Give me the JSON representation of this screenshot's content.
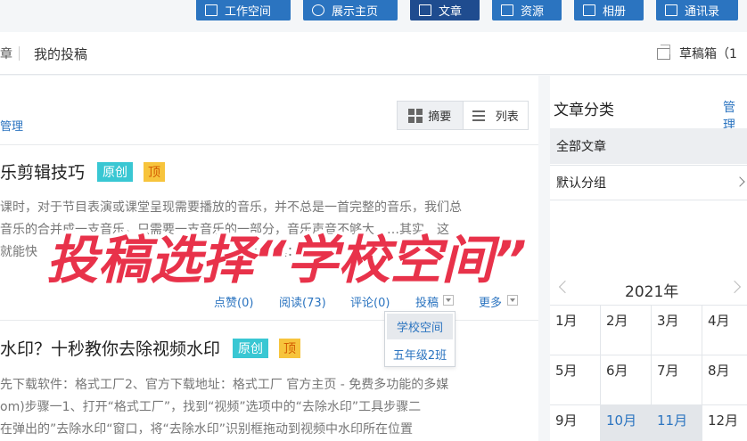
{
  "nav": {
    "items": [
      {
        "label": "工作空间",
        "icon": "workspace-icon"
      },
      {
        "label": "展示主页",
        "icon": "user-icon"
      },
      {
        "label": "文章",
        "icon": "article-icon"
      },
      {
        "label": "资源",
        "icon": "resource-icon"
      },
      {
        "label": "相册",
        "icon": "album-icon"
      },
      {
        "label": "通讯录",
        "icon": "contacts-icon"
      }
    ]
  },
  "tabs": {
    "left_fragment": "章",
    "my_posts": "我的投稿",
    "drafts": "草稿箱（1"
  },
  "main": {
    "manage_fragment": "管理",
    "view_summary": "摘要",
    "view_list": "列表",
    "articles": [
      {
        "title": "乐剪辑技巧",
        "tag_original": "原创",
        "tag_top": "顶",
        "body": [
          "课时，对于节目表演或课堂呈现需要播放的音乐，并不总是一首完整的音乐，我们总",
          "音乐的合并成一支音乐，只需要一支音乐的一部分，音乐声音不够大……其实，这",
          "就能快　　　　　　　　　　　　　　　　　备工具：下"
        ],
        "meta": {
          "likes": "点赞(0)",
          "reads": "阅读(73)",
          "comments": "评论(0)",
          "submit": "投稿",
          "more": "更多"
        }
      },
      {
        "title": "水印？十秒教你去除视频水印",
        "tag_original": "原创",
        "tag_top": "顶",
        "body": [
          "先下载软件：格式工厂2、官方下载地址：格式工厂 官方主页 - 免费多功能的多媒",
          "om)步骤一1、打开“格式工厂”，找到“视频”选项中的“去除水印”工具步骤二",
          "在弹出的”去除水印“窗口，将“去除水印”识别框拖动到视频中水印所在位置"
        ]
      }
    ],
    "dropdown": [
      "学校空间",
      "五年级2班"
    ]
  },
  "sidebar": {
    "title": "文章分类",
    "manage": "管理",
    "categories": [
      "全部文章",
      "默认分组"
    ],
    "calendar": {
      "year": "2021年",
      "months": [
        "1月",
        "2月",
        "3月",
        "4月",
        "5月",
        "6月",
        "7月",
        "8月",
        "9月",
        "10月",
        "11月",
        "12月"
      ],
      "highlighted": [
        "10月",
        "11月"
      ]
    }
  },
  "overlay": {
    "caption": "投稿选择“学校空间”",
    "color": "#e8324a"
  }
}
